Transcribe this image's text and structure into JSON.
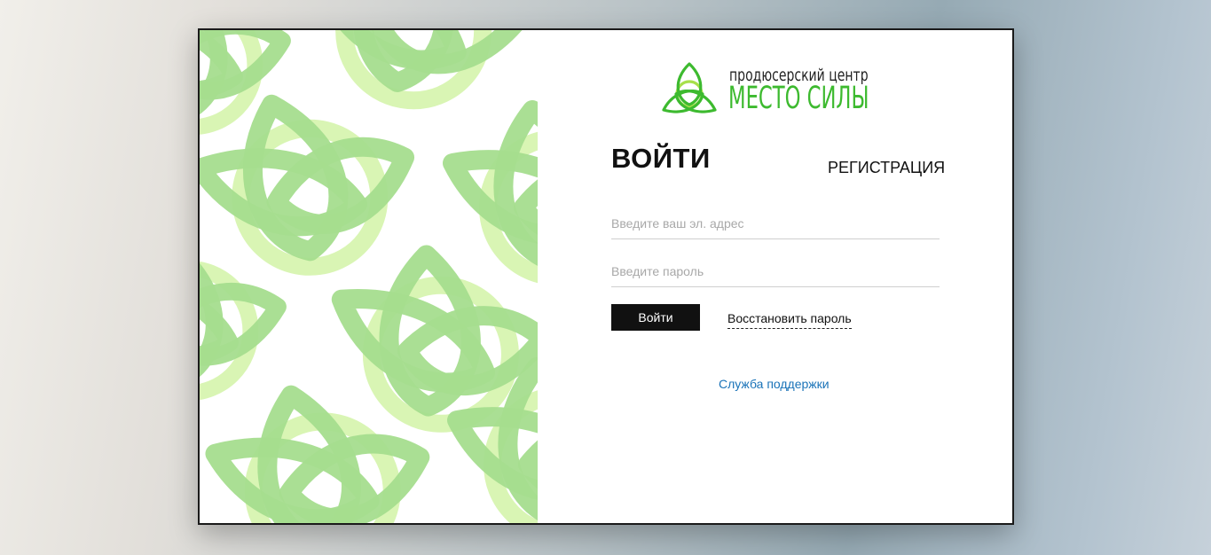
{
  "brand": {
    "line1": "продюсерский центр",
    "line2": "МЕСТО СИЛЫ",
    "logo_icon": "triquetra-icon",
    "accent_color": "#3dba2f"
  },
  "auth": {
    "title": "ВОЙТИ",
    "register_label": "РЕГИСТРАЦИЯ",
    "email_placeholder": "Введите ваш эл. адрес",
    "email_value": "",
    "password_placeholder": "Введите пароль",
    "password_value": "",
    "login_button_label": "Войти",
    "restore_password_label": "Восстановить пароль",
    "support_label": "Служба поддержки"
  },
  "pattern": {
    "icon": "triquetra-pattern-icon",
    "leaf_color": "#a5dd8e",
    "ring_color": "#d9f5b4"
  }
}
